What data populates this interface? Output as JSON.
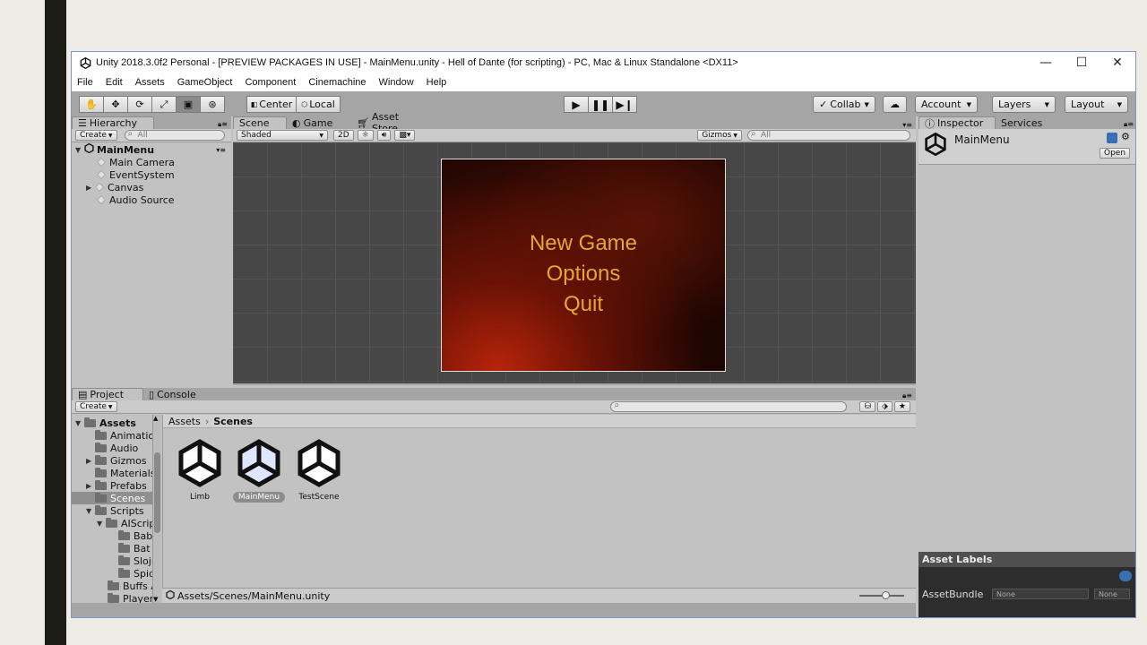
{
  "window": {
    "title": "Unity 2018.3.0f2 Personal - [PREVIEW PACKAGES IN USE] - MainMenu.unity - Hell of Dante (for scripting) - PC, Mac & Linux Standalone <DX11>",
    "controls": {
      "minimize": "—",
      "maximize": "☐",
      "close": "✕"
    }
  },
  "menu": [
    "File",
    "Edit",
    "Assets",
    "GameObject",
    "Component",
    "Cinemachine",
    "Window",
    "Help"
  ],
  "toolbar": {
    "pivot": "Center",
    "space": "Local",
    "collab": "Collab",
    "account": "Account",
    "layers": "Layers",
    "layout": "Layout"
  },
  "hierarchy": {
    "tab": "Hierarchy",
    "create": "Create",
    "search_placeholder": "All",
    "scene": "MainMenu",
    "items": [
      "Main Camera",
      "EventSystem",
      "Canvas",
      "Audio Source"
    ]
  },
  "scene": {
    "tabs": [
      "Scene",
      "Game",
      "Asset Store"
    ],
    "shading": "Shaded",
    "mode_2d": "2D",
    "gizmos": "Gizmos",
    "search_placeholder": "All",
    "menu_items": [
      "New Game",
      "Options",
      "Quit"
    ]
  },
  "inspector": {
    "tabs": [
      "Inspector",
      "Services"
    ],
    "object_name": "MainMenu",
    "open_button": "Open",
    "asset_labels": "Asset Labels",
    "asset_bundle": "AssetBundle",
    "bundle_none_1": "None",
    "bundle_none_2": "None"
  },
  "project": {
    "tabs": [
      "Project",
      "Console"
    ],
    "create": "Create",
    "tree": {
      "root": "Assets",
      "items": [
        "Animation",
        "Audio",
        "Gizmos",
        "Materials",
        "Prefabs",
        "Scenes",
        "Scripts",
        "AIScrip",
        "Babe",
        "Bat",
        "Slojn",
        "Spid",
        "Buffs A",
        "Player"
      ]
    },
    "breadcrumb": {
      "root": "Assets",
      "current": "Scenes"
    },
    "assets": [
      {
        "name": "Limb"
      },
      {
        "name": "MainMenu"
      },
      {
        "name": "TestScene"
      }
    ],
    "status_path": "Assets/Scenes/MainMenu.unity"
  },
  "colors": {
    "menu_text": "#e8a62a",
    "selection": "#8c8c8c"
  }
}
